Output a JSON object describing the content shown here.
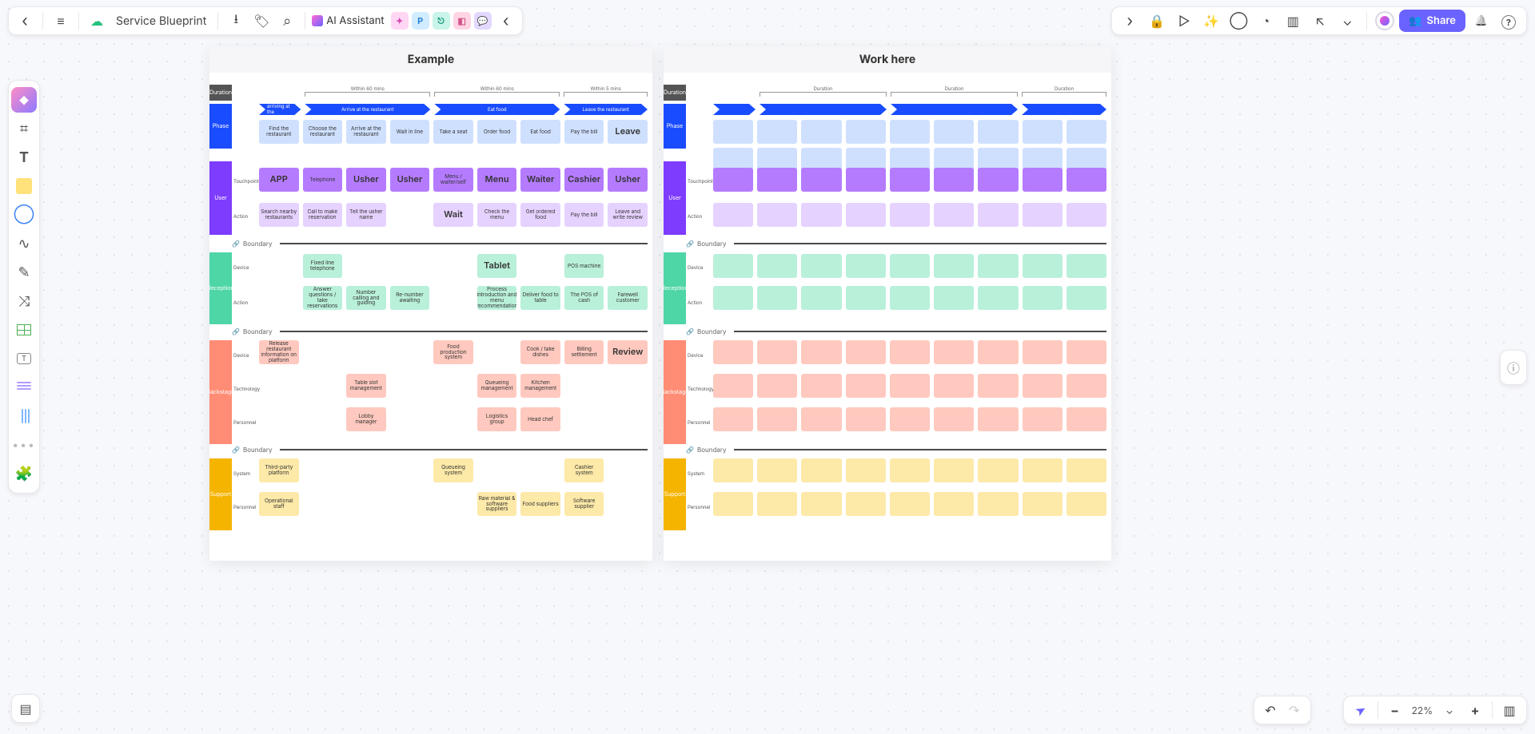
{
  "header": {
    "doc_title": "Service Blueprint",
    "ai_label": "AI Assistant",
    "share": "Share",
    "zoom": "22%"
  },
  "frames": {
    "example": {
      "title": "Example",
      "duration_label": "Duration",
      "durations": [
        "Within 60 mins",
        "Within 60 mins",
        "Within 5 mins"
      ],
      "phase_label": "Phase",
      "phase_arrows": [
        "Before arriving at the restaurant",
        "Arrive at the restaurant",
        "Eat food",
        "Leave the restaurant"
      ],
      "phase_cells": [
        "Find the restaurant",
        "Choose the restaurant",
        "Arrive at the restaurant",
        "Wait in line",
        "Take a seat",
        "Order food",
        "Eat food",
        "Pay the bill",
        "Leave"
      ],
      "user_label": "User",
      "tp_label": "Touchpoint",
      "touchpoints": [
        "APP",
        "Telephone",
        "Usher",
        "Usher",
        "Menu / waiter/self",
        "Menu",
        "Waiter",
        "Cashier",
        "Usher"
      ],
      "action_label": "Action",
      "user_actions": [
        "Search nearby restaurants",
        "Call to make reservation",
        "Tell the usher name",
        "",
        "Wait",
        "Check the menu",
        "Get ordered food",
        "Pay the bill",
        "Leave and write review"
      ],
      "boundary": "Boundary",
      "reception_label": "Reception",
      "device_label": "Device",
      "rec_devices": [
        "",
        "Fixed line telephone",
        "",
        "",
        "",
        "Tablet",
        "",
        "POS machine",
        ""
      ],
      "rec_actions": [
        "",
        "Answer questions / take reservations",
        "Number calling and guiding",
        "Re-number awaiting",
        "",
        "Process introduction and menu recommendation",
        "Deliver food to table",
        "The POS of cash",
        "Farewell customer"
      ],
      "backstage_label": "Backstage",
      "tech_label": "Technology",
      "personnel_label": "Personnel",
      "bk_devices": [
        "Release restaurant information on platform",
        "",
        "",
        "",
        "Food production system",
        "",
        "Cook / take dishes",
        "Billing settlement",
        "Review"
      ],
      "bk_tech": [
        "",
        "",
        "Table slot management",
        "",
        "",
        "Queueing management",
        "Kitchen management",
        "",
        ""
      ],
      "bk_personnel": [
        "",
        "",
        "Lobby manager",
        "",
        "",
        "Logistics group",
        "Head chef",
        "",
        ""
      ],
      "support_label": "Support",
      "system_label": "System",
      "sup_system": [
        "Third-party platform",
        "",
        "",
        "",
        "Queueing system",
        "",
        "",
        "Cashier system",
        ""
      ],
      "sup_personnel": [
        "Operational staff",
        "",
        "",
        "",
        "",
        "Raw material & software suppliers",
        "Food suppliers",
        "Software supplier",
        ""
      ]
    },
    "work": {
      "title": "Work here",
      "duration_label": "Duration",
      "phase_label": "Phase",
      "user_label": "User",
      "tp_label": "Touchpoint",
      "action_label": "Action",
      "boundary": "Boundary",
      "reception_label": "Reception",
      "device_label": "Device",
      "backstage_label": "Backstage",
      "tech_label": "Technology",
      "personnel_label": "Personnel",
      "support_label": "Support",
      "system_label": "System",
      "dur_text": "Duration"
    }
  }
}
